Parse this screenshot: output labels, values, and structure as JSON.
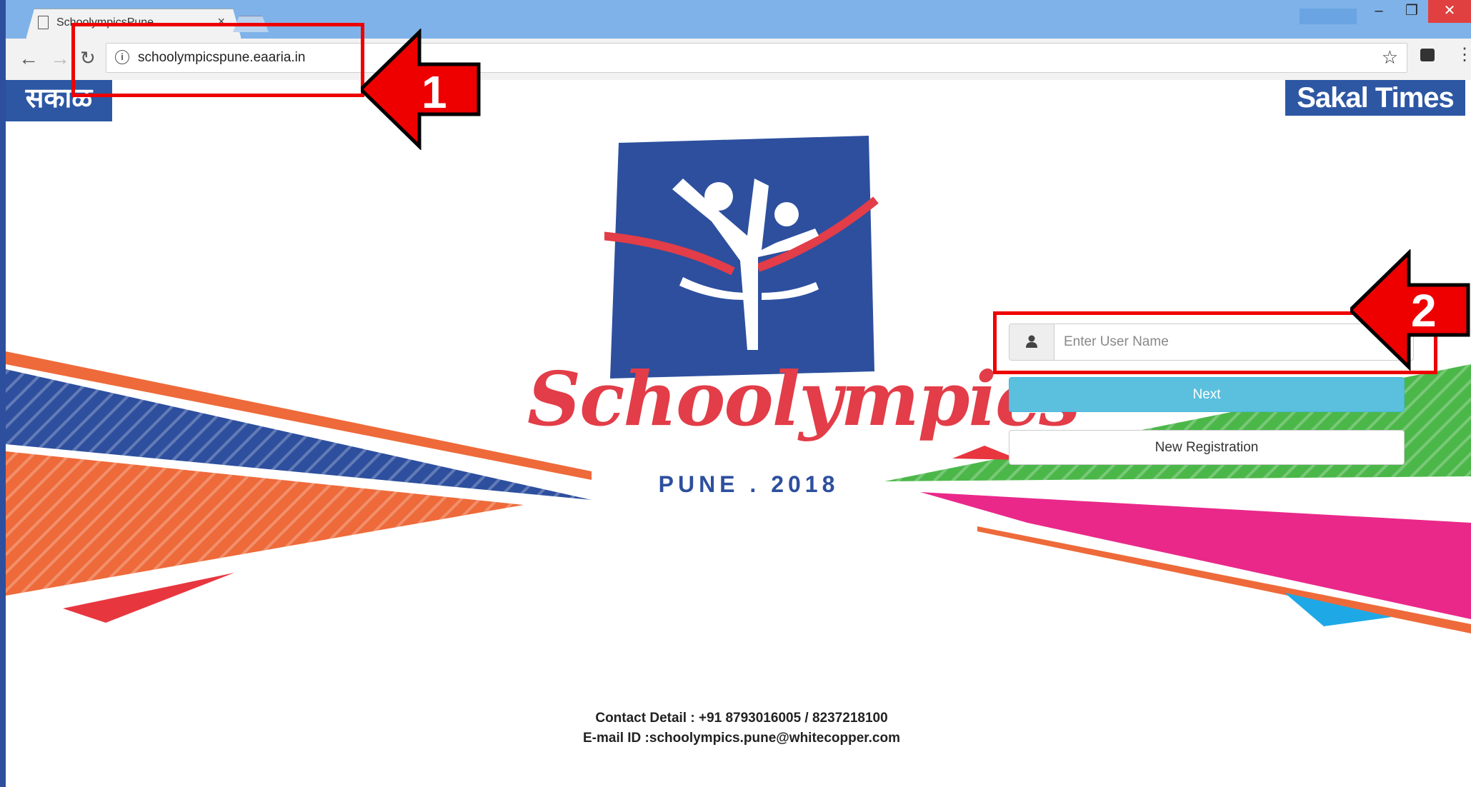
{
  "browser": {
    "tab_title": "SchoolympicsPune",
    "url": "schoolympicspune.eaaria.in",
    "window_controls": {
      "minimize": "–",
      "restore": "❐",
      "close": "✕"
    }
  },
  "page": {
    "left_logo": "सकाळ",
    "right_logo": "Sakal Times",
    "brand_name": "Schoolympics",
    "brand_sub": "PUNE . 2018",
    "username_placeholder": "Enter User Name",
    "next_label": "Next",
    "registration_label": "New Registration",
    "contact_line": "Contact Detail : +91 8793016005 / 8237218100",
    "email_line": "E-mail ID :schoolympics.pune@whitecopper.com"
  },
  "annotations": [
    {
      "number": "1",
      "target": "address bar"
    },
    {
      "number": "2",
      "target": "user name field"
    }
  ],
  "colors": {
    "frame": "#2d4f9e",
    "brand_red": "#e23d48",
    "brand_blue": "#2d4f9e",
    "next_button": "#5bc0de",
    "annotation_red": "#e00000"
  }
}
